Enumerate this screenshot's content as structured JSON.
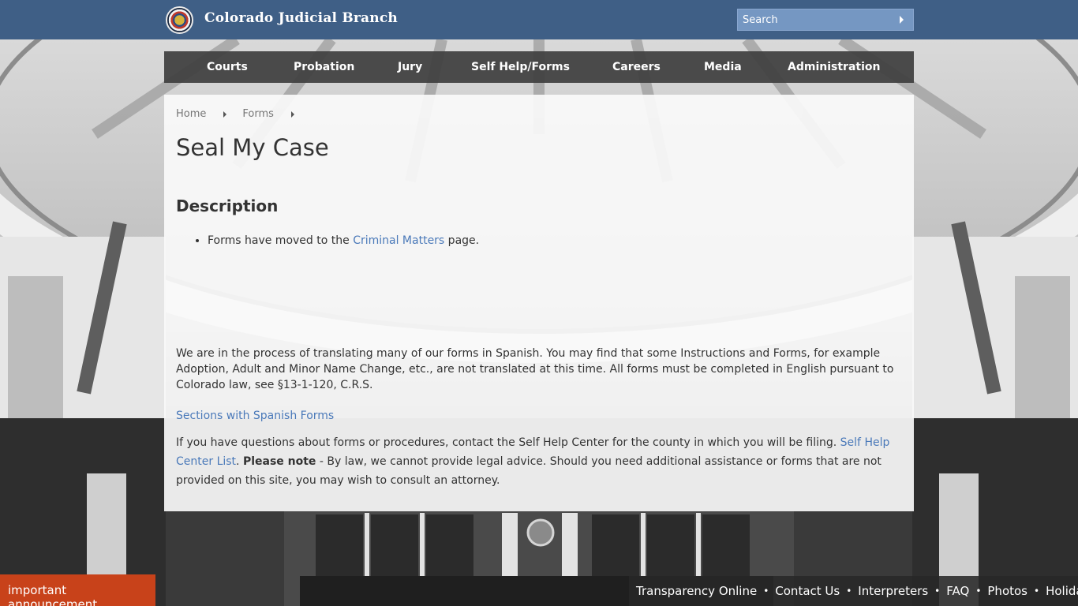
{
  "header": {
    "title": "Colorado Judicial Branch",
    "search_placeholder": "Search"
  },
  "nav": {
    "items": [
      "Courts",
      "Probation",
      "Jury",
      "Self Help/Forms",
      "Careers",
      "Media",
      "Administration"
    ]
  },
  "breadcrumb": {
    "items": [
      "Home",
      "Forms"
    ]
  },
  "page": {
    "title": "Seal My Case",
    "description_heading": "Description",
    "bullet_prefix": "Forms have moved to the ",
    "bullet_link": "Criminal Matters",
    "bullet_suffix": " page.",
    "translation_note": "We are in the process of translating many of our forms in Spanish. You may find that some Instructions and Forms, for example Adoption, Adult and Minor Name Change, etc., are not translated at this time. All forms must be completed in English pursuant to Colorado law, see §13-1-120, C.R.S.",
    "spanish_link": "Sections with Spanish Forms",
    "questions_text": "If you have questions about forms or procedures, contact the Self Help Center for the county in which you will be filing. ",
    "self_help_link": "Self Help Center List",
    "period": ". ",
    "please_note": "Please note",
    "legal_text": " - By law, we cannot provide legal advice. Should you need additional assistance or forms that are not provided on this site, you may wish to consult an attorney."
  },
  "announcement": "important announcement",
  "footer": {
    "links": [
      "Transparency Online",
      "Contact Us",
      "Interpreters",
      "FAQ",
      "Photos",
      "Holidays"
    ],
    "separator": "•"
  },
  "colors": {
    "header_bg": "#3f5f86",
    "nav_bg": "#3f3f3f",
    "link": "#4a79b9",
    "announcement_bg": "#c8421a"
  }
}
